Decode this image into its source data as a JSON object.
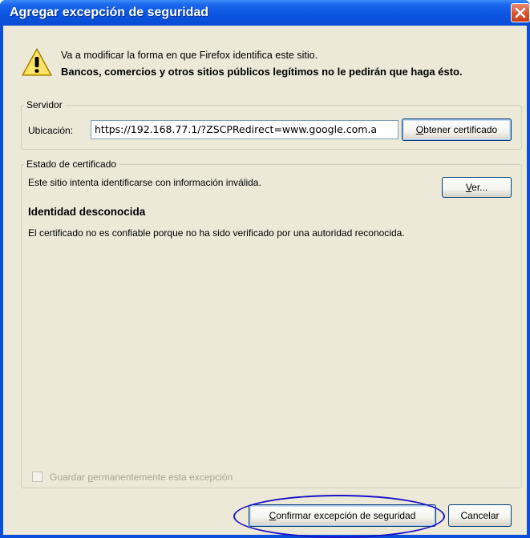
{
  "window": {
    "title": "Agregar excepción de seguridad",
    "close_icon": "close-icon"
  },
  "message": {
    "icon": "warning-icon",
    "line1": "Va a modificar la forma en que Firefox identifica este sitio.",
    "line2": "Bancos, comercios y otros sitios públicos legítimos no le pedirán que haga ésto."
  },
  "server": {
    "legend": "Servidor",
    "location_label": "Ubicación:",
    "location_value": "https://192.168.77.1/?ZSCPRedirect=www.google.com.a",
    "get_cert_button_prefix": "O",
    "get_cert_button_rest": "btener certificado"
  },
  "cert_status": {
    "legend": "Estado de certificado",
    "info": "Este sitio intenta identificarse con información inválida.",
    "view_button_prefix": "V",
    "view_button_rest": "er...",
    "heading": "Identidad desconocida",
    "detail": "El certificado no es confiable porque no ha sido verificado por una autoridad reconocida."
  },
  "permanent": {
    "checked": false,
    "label_pre": "Guardar ",
    "label_ul": "p",
    "label_post": "ermanentemente esta excepción"
  },
  "actions": {
    "confirm_prefix": "C",
    "confirm_rest": "onfirmar excepción de seguridad",
    "cancel": "Cancelar"
  },
  "colors": {
    "titlebar": "#0a55e2",
    "dialog_bg": "#ece9d8",
    "annotation": "#1a10c8"
  }
}
